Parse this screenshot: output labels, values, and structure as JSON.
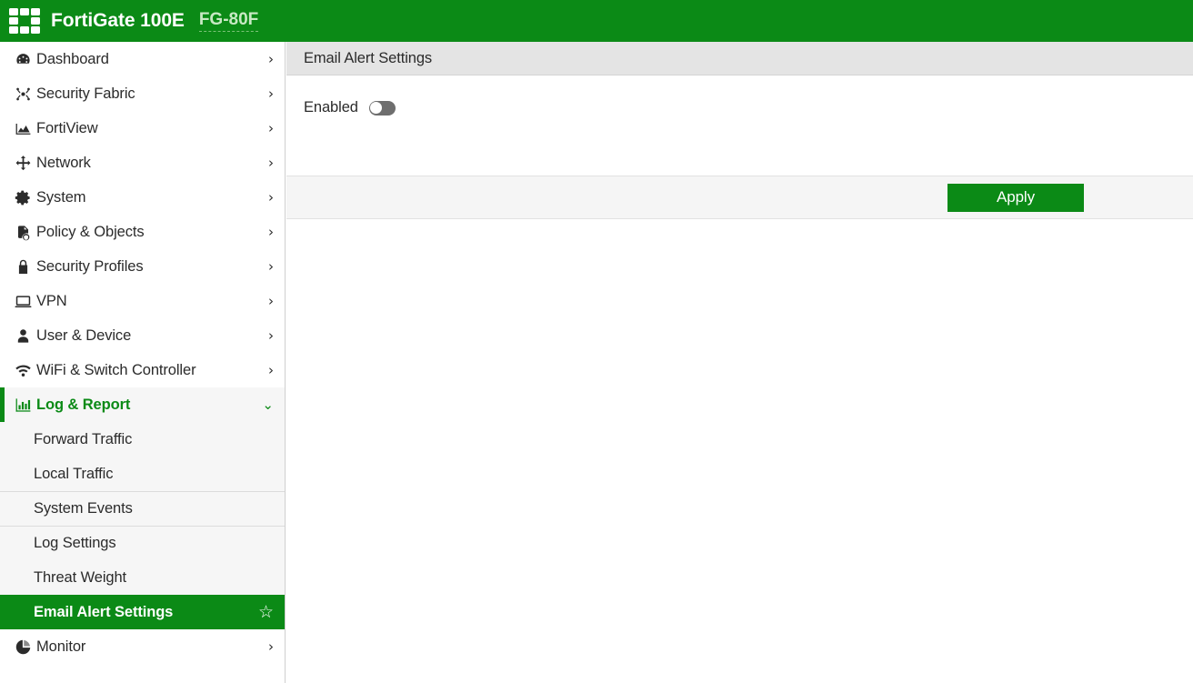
{
  "banner": {
    "logo_icon": "fortinet-grid-logo-icon",
    "product_name": "FortiGate 100E",
    "hostname": "FG-80F"
  },
  "sidebar": {
    "items": [
      {
        "label": "Dashboard",
        "icon": "dashboard-icon",
        "chevron": "›"
      },
      {
        "label": "Security Fabric",
        "icon": "security-fabric-icon",
        "chevron": "›"
      },
      {
        "label": "FortiView",
        "icon": "fortiview-chart-icon",
        "chevron": "›"
      },
      {
        "label": "Network",
        "icon": "network-move-icon",
        "chevron": "›"
      },
      {
        "label": "System",
        "icon": "gear-icon",
        "chevron": "›"
      },
      {
        "label": "Policy & Objects",
        "icon": "policy-objects-icon",
        "chevron": "›"
      },
      {
        "label": "Security Profiles",
        "icon": "lock-icon",
        "chevron": "›"
      },
      {
        "label": "VPN",
        "icon": "monitor-icon",
        "chevron": "›"
      },
      {
        "label": "User & Device",
        "icon": "user-icon",
        "chevron": "›"
      },
      {
        "label": "WiFi & Switch Controller",
        "icon": "wifi-icon",
        "chevron": "›"
      },
      {
        "label": "Log & Report",
        "icon": "bar-chart-icon",
        "chevron": "⌄",
        "expanded": true
      },
      {
        "label": "Monitor",
        "icon": "pie-chart-icon",
        "chevron": "›"
      }
    ],
    "log_report_children": [
      {
        "label": "Forward Traffic"
      },
      {
        "label": "Local Traffic"
      },
      {
        "label": "System Events"
      },
      {
        "label": "Log Settings"
      },
      {
        "label": "Threat Weight"
      },
      {
        "label": "Email Alert Settings",
        "selected": true,
        "star_icon": "star-outline-icon",
        "star_glyph": "☆"
      }
    ]
  },
  "content": {
    "header_title": "Email Alert Settings",
    "enabled_label": "Enabled",
    "enabled_value": false,
    "apply_label": "Apply"
  },
  "colors": {
    "brand_green": "#0b8a16",
    "header_bar_gray": "#e4e4e4",
    "footer_gray": "#f5f5f5",
    "subitem_gray": "#f6f6f6",
    "toggle_off_gray": "#6e6e6e"
  }
}
